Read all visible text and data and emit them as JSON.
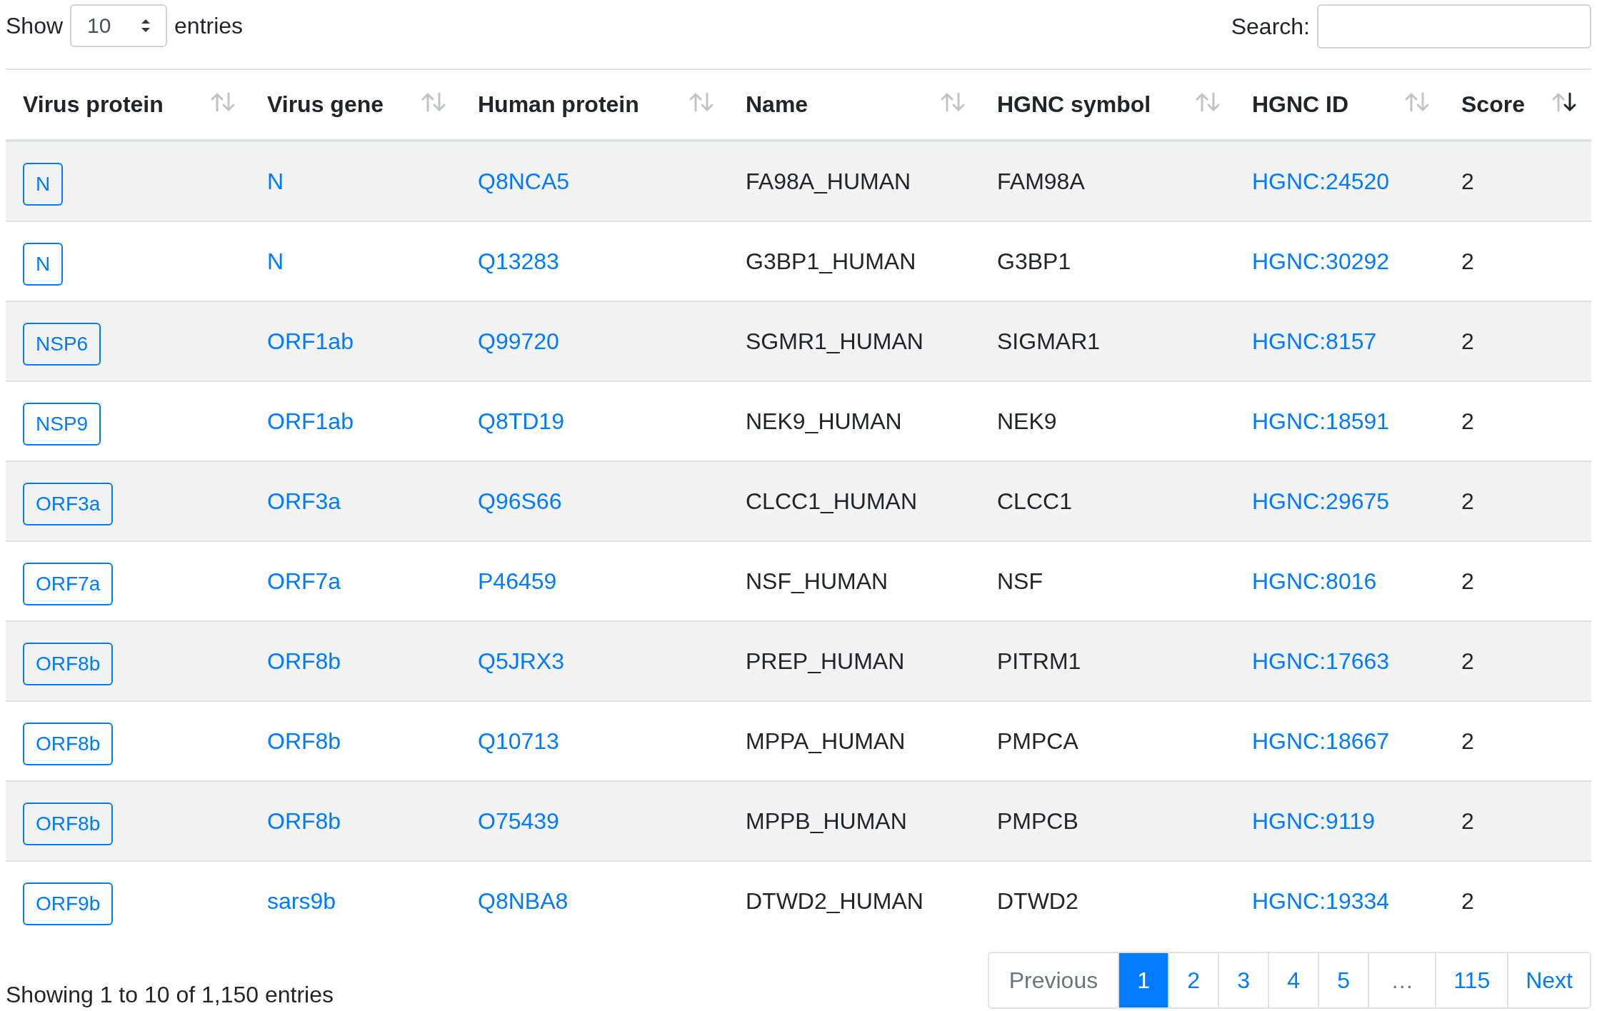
{
  "length_control": {
    "before": "Show",
    "value": "10",
    "after": "entries"
  },
  "search": {
    "label": "Search:"
  },
  "table": {
    "columns": [
      {
        "label": "Virus protein",
        "sorted_desc": false
      },
      {
        "label": "Virus gene",
        "sorted_desc": false
      },
      {
        "label": "Human protein",
        "sorted_desc": false
      },
      {
        "label": "Name",
        "sorted_desc": false
      },
      {
        "label": "HGNC symbol",
        "sorted_desc": false
      },
      {
        "label": "HGNC ID",
        "sorted_desc": false
      },
      {
        "label": "Score",
        "sorted_desc": true
      }
    ],
    "rows": [
      {
        "virus_protein": "N",
        "virus_gene": "N",
        "human_protein": "Q8NCA5",
        "name": "FA98A_HUMAN",
        "hgnc_symbol": "FAM98A",
        "hgnc_id": "HGNC:24520",
        "score": "2"
      },
      {
        "virus_protein": "N",
        "virus_gene": "N",
        "human_protein": "Q13283",
        "name": "G3BP1_HUMAN",
        "hgnc_symbol": "G3BP1",
        "hgnc_id": "HGNC:30292",
        "score": "2"
      },
      {
        "virus_protein": "NSP6",
        "virus_gene": "ORF1ab",
        "human_protein": "Q99720",
        "name": "SGMR1_HUMAN",
        "hgnc_symbol": "SIGMAR1",
        "hgnc_id": "HGNC:8157",
        "score": "2"
      },
      {
        "virus_protein": "NSP9",
        "virus_gene": "ORF1ab",
        "human_protein": "Q8TD19",
        "name": "NEK9_HUMAN",
        "hgnc_symbol": "NEK9",
        "hgnc_id": "HGNC:18591",
        "score": "2"
      },
      {
        "virus_protein": "ORF3a",
        "virus_gene": "ORF3a",
        "human_protein": "Q96S66",
        "name": "CLCC1_HUMAN",
        "hgnc_symbol": "CLCC1",
        "hgnc_id": "HGNC:29675",
        "score": "2"
      },
      {
        "virus_protein": "ORF7a",
        "virus_gene": "ORF7a",
        "human_protein": "P46459",
        "name": "NSF_HUMAN",
        "hgnc_symbol": "NSF",
        "hgnc_id": "HGNC:8016",
        "score": "2"
      },
      {
        "virus_protein": "ORF8b",
        "virus_gene": "ORF8b",
        "human_protein": "Q5JRX3",
        "name": "PREP_HUMAN",
        "hgnc_symbol": "PITRM1",
        "hgnc_id": "HGNC:17663",
        "score": "2"
      },
      {
        "virus_protein": "ORF8b",
        "virus_gene": "ORF8b",
        "human_protein": "Q10713",
        "name": "MPPA_HUMAN",
        "hgnc_symbol": "PMPCA",
        "hgnc_id": "HGNC:18667",
        "score": "2"
      },
      {
        "virus_protein": "ORF8b",
        "virus_gene": "ORF8b",
        "human_protein": "O75439",
        "name": "MPPB_HUMAN",
        "hgnc_symbol": "PMPCB",
        "hgnc_id": "HGNC:9119",
        "score": "2"
      },
      {
        "virus_protein": "ORF9b",
        "virus_gene": "sars9b",
        "human_protein": "Q8NBA8",
        "name": "DTWD2_HUMAN",
        "hgnc_symbol": "DTWD2",
        "hgnc_id": "HGNC:19334",
        "score": "2"
      }
    ]
  },
  "info": "Showing 1 to 10 of 1,150 entries",
  "pagination": [
    {
      "kind": "prev",
      "label": "Previous",
      "selected": false,
      "disabled": true
    },
    {
      "kind": "page",
      "label": "1",
      "selected": true,
      "disabled": false
    },
    {
      "kind": "page",
      "label": "2",
      "selected": false,
      "disabled": false
    },
    {
      "kind": "page",
      "label": "3",
      "selected": false,
      "disabled": false
    },
    {
      "kind": "page",
      "label": "4",
      "selected": false,
      "disabled": false
    },
    {
      "kind": "page",
      "label": "5",
      "selected": false,
      "disabled": false
    },
    {
      "kind": "ellipsis",
      "label": "…",
      "selected": false,
      "disabled": true
    },
    {
      "kind": "page",
      "label": "115",
      "selected": false,
      "disabled": false
    },
    {
      "kind": "next",
      "label": "Next",
      "selected": false,
      "disabled": false
    }
  ]
}
